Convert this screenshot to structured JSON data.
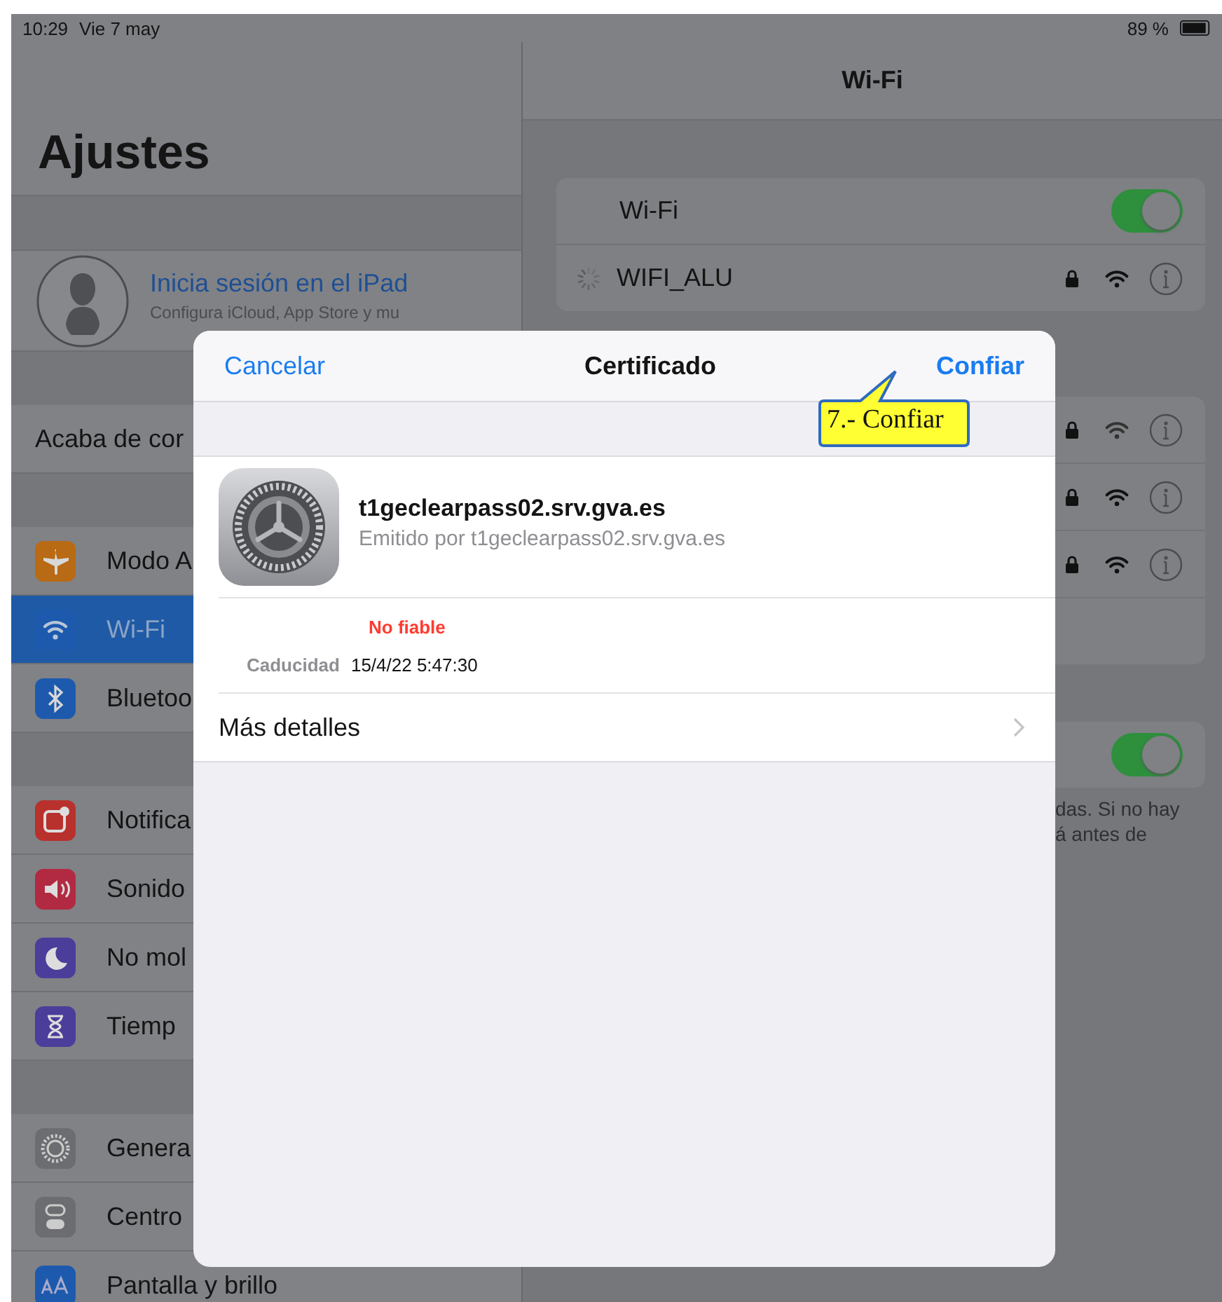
{
  "status_bar": {
    "time": "10:29",
    "date": "Vie 7 may",
    "battery": "89 %"
  },
  "sidebar": {
    "title": "Ajustes",
    "profile": {
      "name": "Inicia sesión en el iPad",
      "subtitle": "Configura iCloud, App Store y mu"
    },
    "groups": [
      {
        "items": [
          {
            "label": "Acaba de cor",
            "selected": false
          }
        ]
      },
      {
        "items": [
          {
            "label": "Modo A",
            "selected": false
          },
          {
            "label": "Wi-Fi",
            "selected": true
          },
          {
            "label": "Bluetoo",
            "selected": false
          }
        ]
      },
      {
        "items": [
          {
            "label": "Notifica",
            "selected": false
          },
          {
            "label": "Sonido",
            "selected": false
          },
          {
            "label": "No mol",
            "selected": false
          },
          {
            "label": "Tiemp",
            "selected": false
          }
        ]
      },
      {
        "items": [
          {
            "label": "Genera",
            "selected": false
          },
          {
            "label": "Centro",
            "selected": false
          },
          {
            "label": "Pantalla y brillo",
            "selected": false
          }
        ]
      }
    ]
  },
  "wifi_panel": {
    "title": "Wi-Fi",
    "toggle_label": "Wi-Fi",
    "toggle_on": true,
    "current_network": {
      "name": "WIFI_ALU",
      "connecting": true,
      "locked": true
    },
    "networks": [
      {
        "locked": true
      },
      {
        "locked": true
      },
      {
        "locked": true
      }
    ],
    "ask_toggle_on": true,
    "footnote": [
      "das. Si no hay",
      "á antes de"
    ]
  },
  "dialog": {
    "title": "Certificado",
    "cancel": "Cancelar",
    "confirm": "Confiar",
    "certificate": {
      "name": "t1geclearpass02.srv.gva.es",
      "issuer": "Emitido por t1geclearpass02.srv.gva.es",
      "status": "No fiable",
      "trusted": false,
      "expiry_label": "Caducidad",
      "expiry": "15/4/22 5:47:30"
    },
    "more": "Más detalles"
  },
  "callout": {
    "text": "7.- Confiar"
  }
}
